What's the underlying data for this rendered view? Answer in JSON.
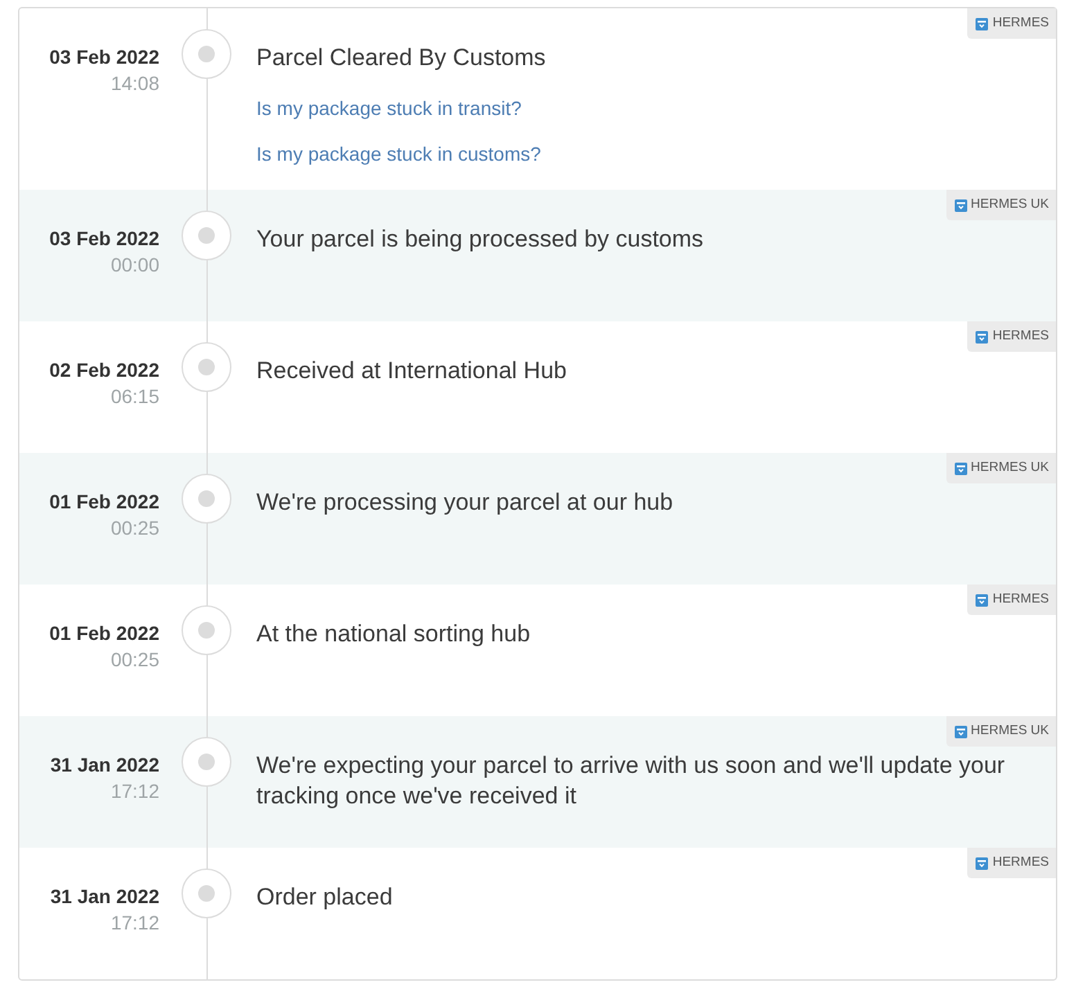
{
  "events": [
    {
      "date": "03 Feb 2022",
      "time": "14:08",
      "title": "Parcel Cleared By Customs",
      "links": [
        "Is my package stuck in transit?",
        "Is my package stuck in customs?"
      ],
      "carrier": "HERMES"
    },
    {
      "date": "03 Feb 2022",
      "time": "00:00",
      "title": "Your parcel is being processed by customs",
      "carrier": "HERMES UK"
    },
    {
      "date": "02 Feb 2022",
      "time": "06:15",
      "title": "Received at International Hub",
      "carrier": "HERMES"
    },
    {
      "date": "01 Feb 2022",
      "time": "00:25",
      "title": "We're processing your parcel at our hub",
      "carrier": "HERMES UK"
    },
    {
      "date": "01 Feb 2022",
      "time": "00:25",
      "title": "At the national sorting hub",
      "carrier": "HERMES"
    },
    {
      "date": "31 Jan 2022",
      "time": "17:12",
      "title": "We're expecting your parcel to arrive with us soon and we'll update your tracking once we've received it",
      "carrier": "HERMES UK"
    },
    {
      "date": "31 Jan 2022",
      "time": "17:12",
      "title": "Order placed",
      "carrier": "HERMES"
    }
  ]
}
